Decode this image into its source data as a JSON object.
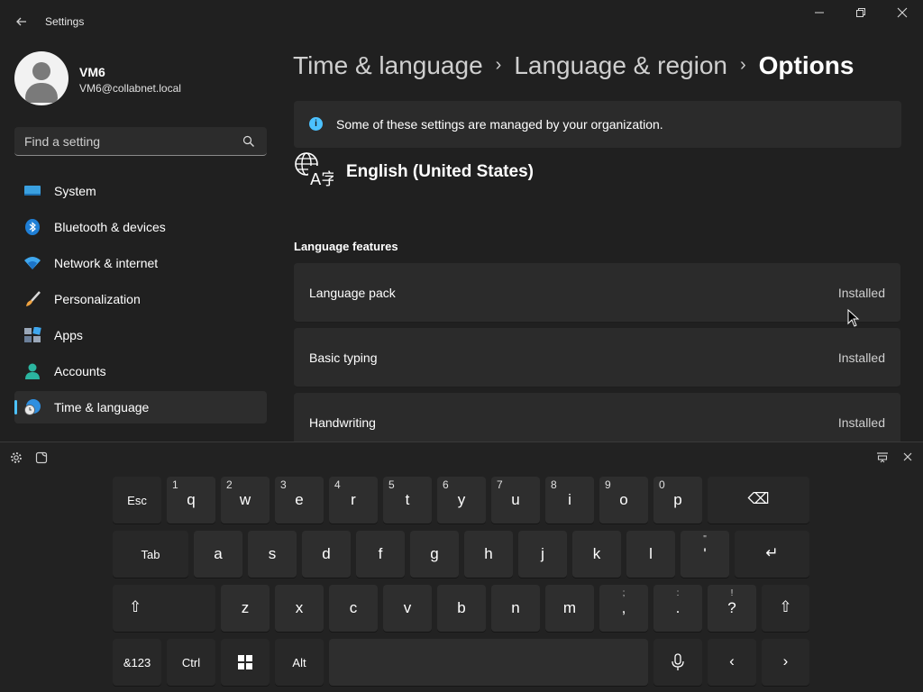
{
  "window": {
    "title": "Settings",
    "controls": {
      "minimize": "—",
      "maximize": "❐",
      "close": "✕"
    }
  },
  "profile": {
    "name": "VM6",
    "email": "VM6@collabnet.local"
  },
  "search": {
    "placeholder": "Find a setting"
  },
  "sidebar": {
    "items": [
      {
        "label": "System",
        "icon": "monitor-icon"
      },
      {
        "label": "Bluetooth & devices",
        "icon": "bluetooth-icon"
      },
      {
        "label": "Network & internet",
        "icon": "wifi-icon"
      },
      {
        "label": "Personalization",
        "icon": "brush-icon"
      },
      {
        "label": "Apps",
        "icon": "apps-icon"
      },
      {
        "label": "Accounts",
        "icon": "person-icon"
      },
      {
        "label": "Time & language",
        "icon": "globe-clock-icon",
        "active": true
      }
    ]
  },
  "breadcrumb": {
    "items": [
      "Time & language",
      "Language & region"
    ],
    "separator": "›",
    "current": "Options"
  },
  "info_bar": {
    "text": "Some of these settings are managed by your organization."
  },
  "language": {
    "name": "English (United States)"
  },
  "features": {
    "title": "Language features",
    "items": [
      {
        "label": "Language pack",
        "status": "Installed"
      },
      {
        "label": "Basic typing",
        "status": "Installed"
      },
      {
        "label": "Handwriting",
        "status": "Installed"
      }
    ]
  },
  "keyboard": {
    "row1": {
      "esc": "Esc",
      "keys": [
        {
          "main": "q",
          "alt": "1"
        },
        {
          "main": "w",
          "alt": "2"
        },
        {
          "main": "e",
          "alt": "3"
        },
        {
          "main": "r",
          "alt": "4"
        },
        {
          "main": "t",
          "alt": "5"
        },
        {
          "main": "y",
          "alt": "6"
        },
        {
          "main": "u",
          "alt": "7"
        },
        {
          "main": "i",
          "alt": "8"
        },
        {
          "main": "o",
          "alt": "9"
        },
        {
          "main": "p",
          "alt": "0"
        }
      ],
      "backspace": "⌫"
    },
    "row2": {
      "tab": "Tab",
      "keys": [
        "a",
        "s",
        "d",
        "f",
        "g",
        "h",
        "j",
        "k",
        "l"
      ],
      "apostrophe": {
        "main": "'",
        "alt": "\""
      },
      "enter": "↵"
    },
    "row3": {
      "shift": "⇧",
      "keys": [
        "z",
        "x",
        "c",
        "v",
        "b",
        "n",
        "m"
      ],
      "comma": {
        "main": ",",
        "alt": ";"
      },
      "period": {
        "main": ".",
        "alt": ":"
      },
      "question": {
        "main": "?",
        "alt": "!"
      }
    },
    "row4": {
      "symbols": "&123",
      "ctrl": "Ctrl",
      "alt": "Alt",
      "left": "‹",
      "right": "›"
    }
  }
}
